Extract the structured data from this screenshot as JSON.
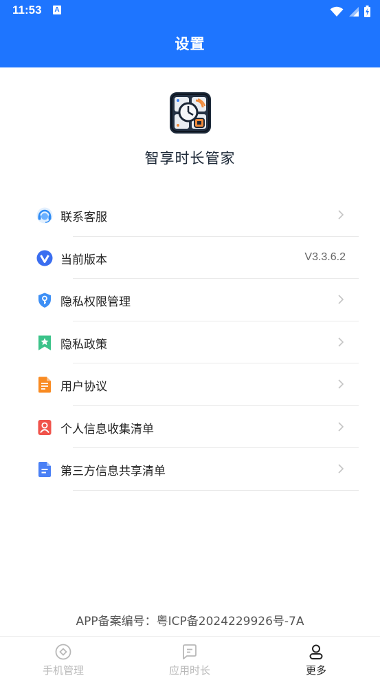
{
  "status_bar": {
    "time": "11:53",
    "notification_glyph": "A"
  },
  "header": {
    "title": "设置"
  },
  "app": {
    "name": "智享时长管家"
  },
  "menu": {
    "items": [
      {
        "label": "联系客服",
        "icon": "headset-icon",
        "icon_color": "#2f8cf5"
      },
      {
        "label": "当前版本",
        "icon": "v-logo-icon",
        "icon_color": "#3b6ef0",
        "value": "V3.3.6.2"
      },
      {
        "label": "隐私权限管理",
        "icon": "shield-key-icon",
        "icon_color": "#3d8ff5"
      },
      {
        "label": "隐私政策",
        "icon": "bookmark-star-icon",
        "icon_color": "#3cc38a"
      },
      {
        "label": "用户协议",
        "icon": "document-icon",
        "icon_color": "#f98b22"
      },
      {
        "label": "个人信息收集清单",
        "icon": "person-card-icon",
        "icon_color": "#f0534b"
      },
      {
        "label": "第三方信息共享清单",
        "icon": "file-list-icon",
        "icon_color": "#4a80f5"
      }
    ]
  },
  "footer": {
    "icp": "APP备案编号：粤ICP备2024229926号-7A"
  },
  "tabbar": {
    "tabs": [
      {
        "label": "手机管理",
        "active": false
      },
      {
        "label": "应用时长",
        "active": false
      },
      {
        "label": "更多",
        "active": true
      }
    ]
  },
  "colors": {
    "primary": "#1e75ff",
    "divider": "#e9e9e9",
    "inactive_tab": "#b8b8b8"
  }
}
